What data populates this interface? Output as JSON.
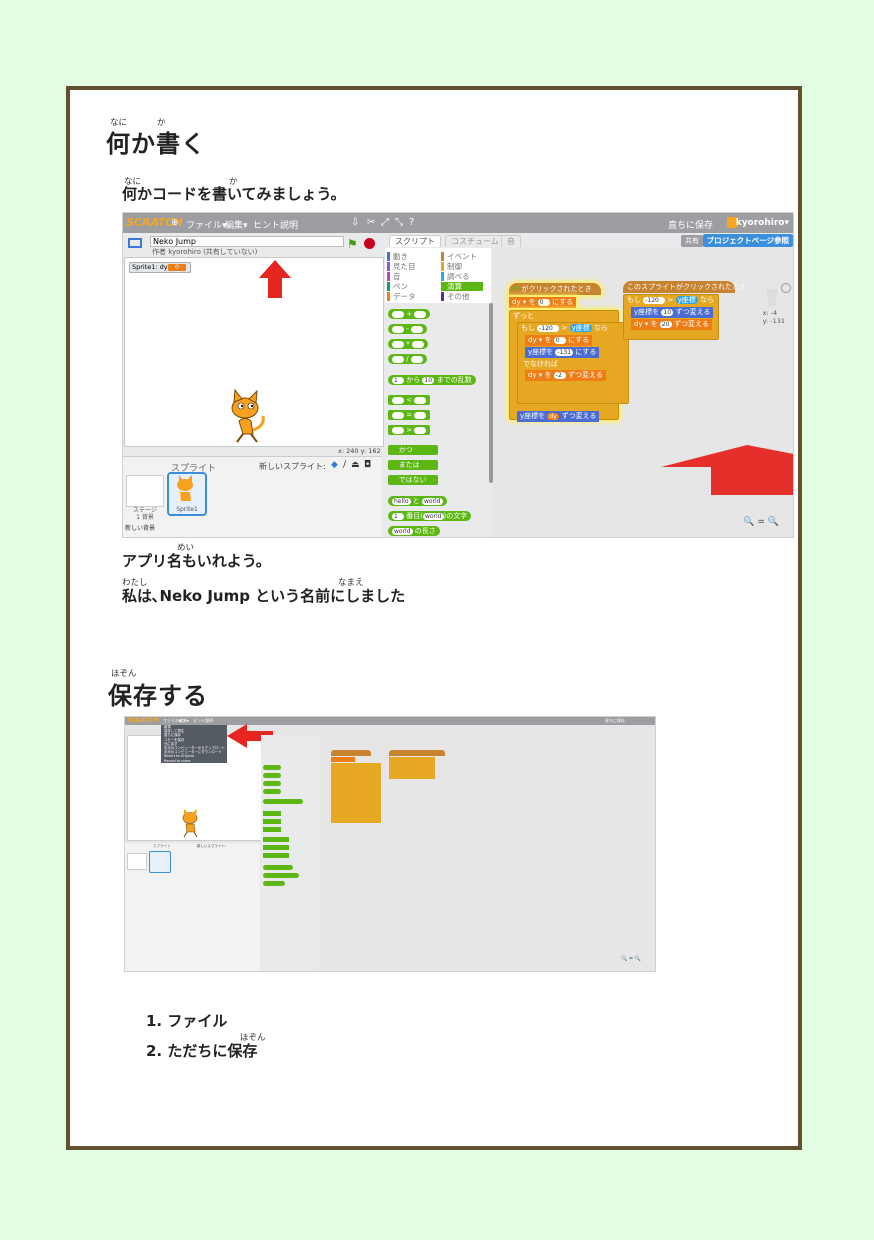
{
  "section1": {
    "title_ruby": [
      "なに",
      "か"
    ],
    "title": "何か書く",
    "intro_ruby": [
      "なに",
      "か"
    ],
    "intro": "何かコードを書いてみましょう。",
    "after_ruby": [
      "めい"
    ],
    "after1": "アプリ名もいれよう。",
    "after2_ruby": [
      "わたし",
      "なまえ"
    ],
    "after2": "私は､Neko Jump という名前にしました"
  },
  "section2": {
    "title_ruby": [
      "ほぞん"
    ],
    "title": "保存する",
    "steps": [
      "1. ファイル",
      "2. ただちに保存"
    ],
    "step2_ruby": "ほぞん"
  },
  "editor": {
    "logo": "SCRATCH",
    "menu": [
      "ファイル▾",
      "編集▾",
      "ヒント",
      "説明"
    ],
    "save_now": "直ちに保存",
    "user": "kyorohiro▾",
    "project_title": "Neko Jump",
    "author": "作者 kyorohiro (共有していない)",
    "monitor_label": "Sprite1: dy",
    "monitor_value": "0",
    "coords": "x: 240  y: 162",
    "sprites_header": "スプライト",
    "new_sprite": "新しいスプライト:",
    "stage_label": "ステージ",
    "stage_bg": "1 背景",
    "sprite_name": "Sprite1",
    "new_backdrop": "新しい背景",
    "tabs": [
      "スクリプト",
      "コスチューム",
      "音"
    ],
    "share": "共有",
    "project_page": "プロジェクトページ参照",
    "categories_left": [
      "動き",
      "見た目",
      "音",
      "ペン",
      "データ"
    ],
    "categories_right": [
      "イベント",
      "制御",
      "調べる",
      "演算",
      "その他"
    ],
    "cat_colors_left": [
      "#4a6cd4",
      "#8a55d7",
      "#bb42c3",
      "#0e9a6c",
      "#ee7d16"
    ],
    "cat_colors_right": [
      "#c88330",
      "#e6a822",
      "#2ca5e2",
      "#5cb712",
      "#632d99"
    ],
    "ops": [
      "+",
      "-",
      "*",
      "/"
    ],
    "pick_random": [
      "1",
      "から",
      "10",
      "までの乱数"
    ],
    "compare": [
      "<",
      "=",
      ">"
    ],
    "logic": [
      "かつ",
      "または",
      "ではない"
    ],
    "join": [
      "hello",
      "と",
      "world"
    ],
    "letter_of": [
      "1",
      "番目(",
      "world",
      ")の文字"
    ],
    "length_of": [
      "world",
      "の長さ"
    ],
    "script1": {
      "hat": "がクリックされたとき",
      "set_dy": [
        "dy ▾",
        "を",
        "0",
        "にする"
      ],
      "forever": "ずっと",
      "if": [
        "もし",
        "-120",
        ">",
        "y座標",
        "なら"
      ],
      "set_dy2": [
        "dy ▾",
        "を",
        "0",
        "にする"
      ],
      "set_y": [
        "y座標を",
        "-131",
        "にする"
      ],
      "else": "でなければ",
      "change_dy": [
        "dy ▾",
        "を",
        "-2",
        "ずつ変える"
      ],
      "change_y": [
        "y座標を",
        "dy",
        "ずつ変える"
      ]
    },
    "script2": {
      "hat": "このスプライトがクリックされたとき",
      "if": [
        "もし",
        "-120",
        ">",
        "y座標",
        "なら"
      ],
      "change_y": [
        "y座標を",
        "10",
        "ずつ変える"
      ],
      "change_dy": [
        "dy ▾",
        "を",
        "20",
        "ずつ変える"
      ]
    },
    "sprite_xy": [
      "x: -4",
      "y: -131"
    ],
    "zoom": "🔍 = 🔍",
    "colors": {
      "arrow": "#e52520",
      "green": "#5cb712"
    }
  },
  "editor2": {
    "file_menu": [
      "新規",
      "保存して再生",
      "直ちに保存",
      "コピーを保存",
      "元に戻す",
      "手元のコンピューターからアップロード",
      "手元のコンピューターにダウンロード",
      "Revert to Original",
      "Record to video"
    ]
  }
}
